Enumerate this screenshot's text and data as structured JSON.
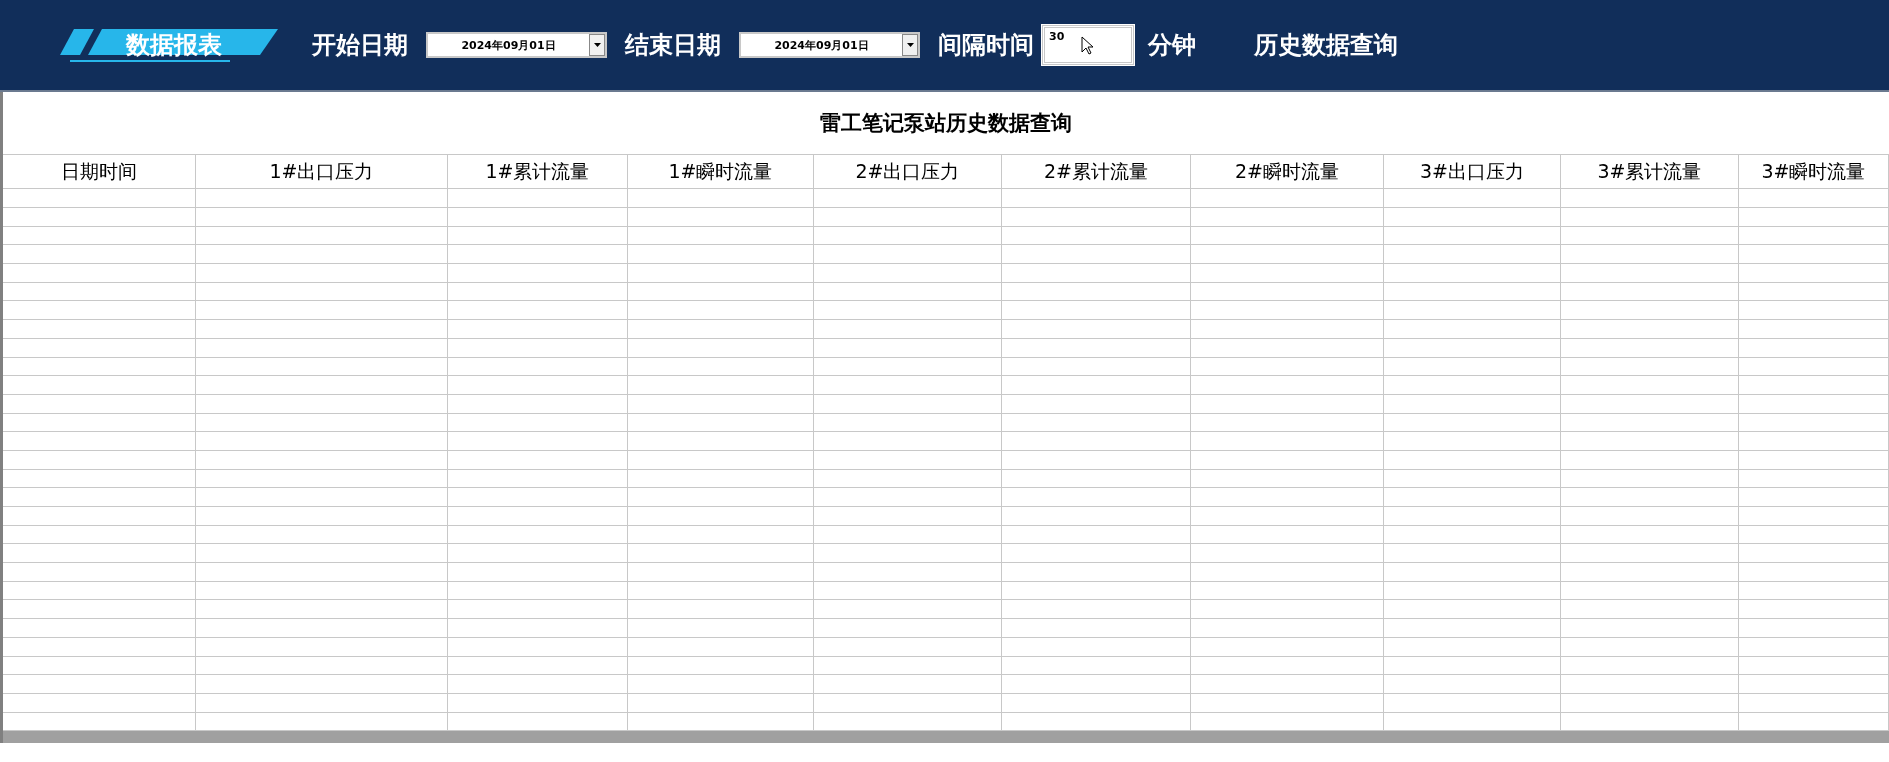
{
  "header": {
    "logo_title": "数据报表",
    "start_date": {
      "label": "开始日期",
      "value": "2024年09月01日"
    },
    "end_date": {
      "label": "结束日期",
      "value": "2024年09月01日"
    },
    "interval": {
      "label": "间隔时间",
      "value": "30",
      "unit": "分钟"
    },
    "query_button": "历史数据查询"
  },
  "table": {
    "title": "雷工笔记泵站历史数据查询",
    "columns": [
      "日期时间",
      "1#出口压力",
      "1#累计流量",
      "1#瞬时流量",
      "2#出口压力",
      "2#累计流量",
      "2#瞬时流量",
      "3#出口压力",
      "3#累计流量",
      "3#瞬时流量"
    ]
  }
}
